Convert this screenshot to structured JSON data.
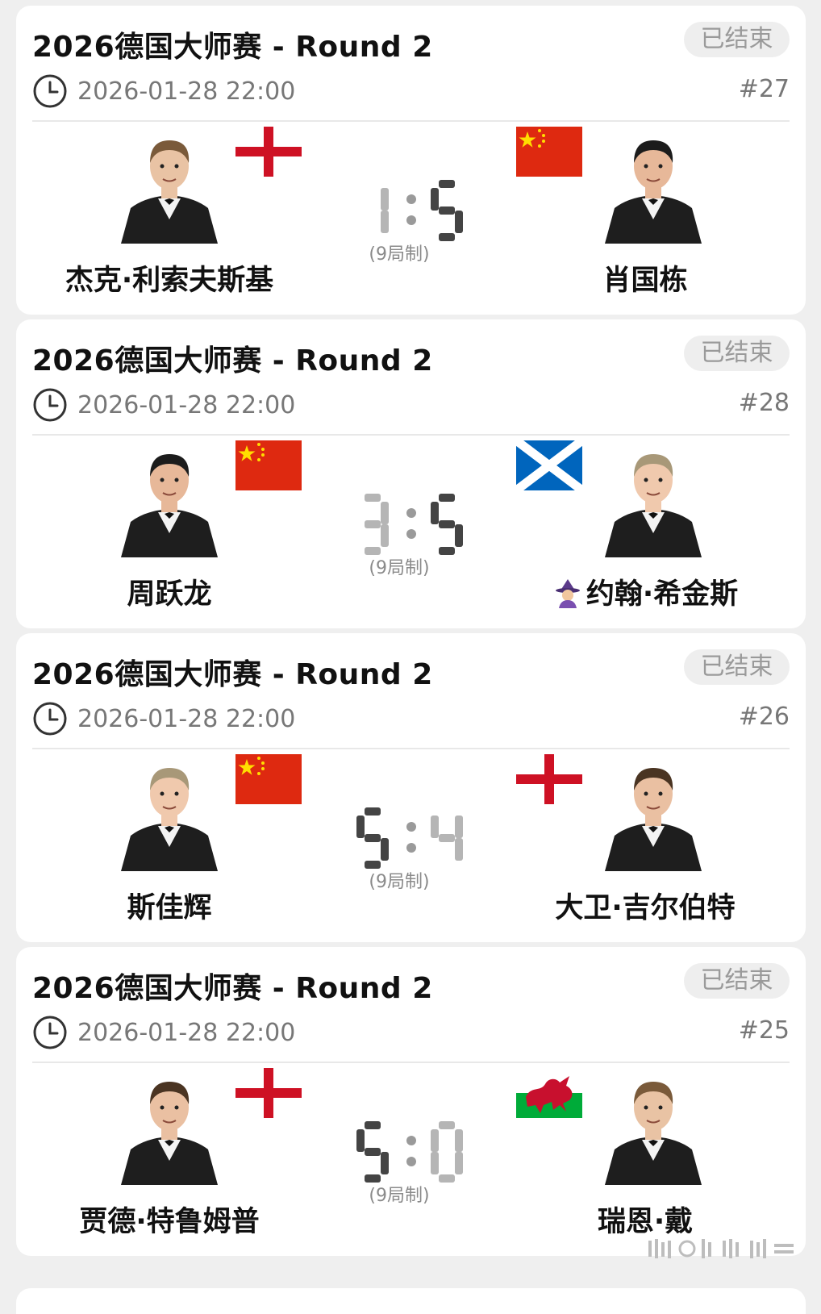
{
  "matches": [
    {
      "title": "2026德国大师赛 - Round 2",
      "status": "已结束",
      "time": "2026-01-28 22:00",
      "match_no": "#27",
      "left": {
        "name": "杰克·利索夫斯基",
        "flag": "england"
      },
      "right": {
        "name": "肖国栋",
        "flag": "china"
      },
      "score_left": "1",
      "score_right": "5",
      "format": "(9局制)"
    },
    {
      "title": "2026德国大师赛 - Round 2",
      "status": "已结束",
      "time": "2026-01-28 22:00",
      "match_no": "#28",
      "left": {
        "name": "周跃龙",
        "flag": "china"
      },
      "right": {
        "name": "约翰·希金斯",
        "flag": "scotland",
        "emoji": "mage-icon"
      },
      "score_left": "3",
      "score_right": "5",
      "format": "(9局制)"
    },
    {
      "title": "2026德国大师赛 - Round 2",
      "status": "已结束",
      "time": "2026-01-28 22:00",
      "match_no": "#26",
      "left": {
        "name": "斯佳辉",
        "flag": "china"
      },
      "right": {
        "name": "大卫·吉尔伯特",
        "flag": "england"
      },
      "score_left": "5",
      "score_right": "4",
      "format": "(9局制)"
    },
    {
      "title": "2026德国大师赛 - Round 2",
      "status": "已结束",
      "time": "2026-01-28 22:00",
      "match_no": "#25",
      "left": {
        "name": "贾德·特鲁姆普",
        "flag": "england"
      },
      "right": {
        "name": "瑞恩·戴",
        "flag": "wales"
      },
      "score_left": "5",
      "score_right": "0",
      "format": "(9局制)"
    }
  ],
  "colors": {
    "card_bg": "#ffffff",
    "page_bg": "#efefef",
    "score_win": "#444444",
    "score_lose": "#b5b5b5",
    "status_bg": "#eeeeee",
    "status_text": "#9a9a9a",
    "china_red": "#de2910",
    "china_star": "#ffde00",
    "england_red": "#ce1124",
    "scotland_blue": "#0065bd",
    "wales_green": "#00ab39"
  }
}
